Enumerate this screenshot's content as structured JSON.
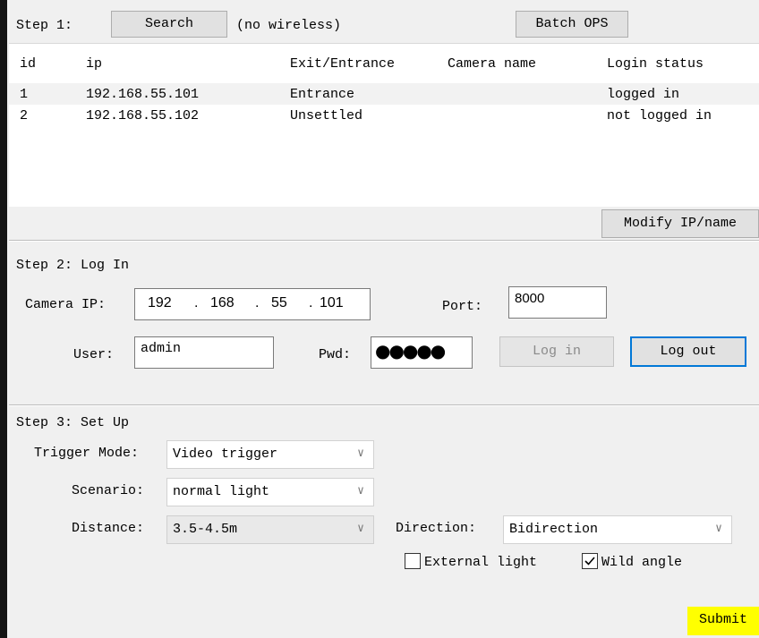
{
  "step1": {
    "label": "Step 1:",
    "search_button": "Search",
    "wireless_status": "(no wireless)",
    "batch_button": "Batch OPS",
    "table": {
      "columns": [
        "id",
        "ip",
        "Exit/Entrance",
        "Camera name",
        "Login status"
      ],
      "rows": [
        [
          "1",
          "192.168.55.101",
          "Entrance",
          "",
          "logged in"
        ],
        [
          "2",
          "192.168.55.102",
          "Unsettled",
          "",
          "not logged in"
        ]
      ]
    },
    "modify_button": "Modify IP/name"
  },
  "step2": {
    "label": "Step 2: Log In",
    "camera_ip_label": "Camera IP:",
    "ip_octets": [
      "192",
      "168",
      "55",
      "101"
    ],
    "ip_dot": ".",
    "port_label": "Port:",
    "port_value": "8000",
    "user_label": "User:",
    "user_value": "admin",
    "pwd_label": "Pwd:",
    "pwd_value": "●●●●●",
    "login_button": "Log in",
    "logout_button": "Log out"
  },
  "step3": {
    "label": "Step 3: Set Up",
    "trigger_label": "Trigger Mode:",
    "trigger_value": "Video trigger",
    "scenario_label": "Scenario:",
    "scenario_value": "normal light",
    "distance_label": "Distance:",
    "distance_value": "3.5-4.5m",
    "direction_label": "Direction:",
    "direction_value": "Bidirection",
    "external_light_label": "External light",
    "external_light_checked": false,
    "wild_angle_label": "Wild angle",
    "wild_angle_checked": true,
    "chevron": "∨",
    "submit_button": "Submit"
  },
  "colors": {
    "submit_bg": "#ffff00",
    "focus_border": "#0078d7"
  }
}
